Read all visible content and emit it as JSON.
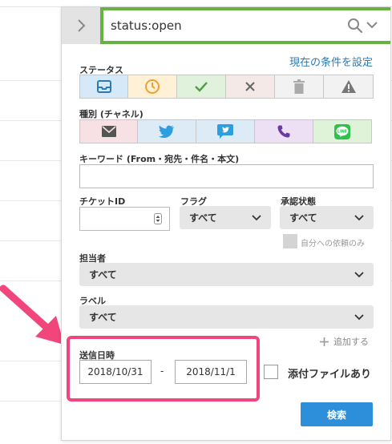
{
  "search": {
    "value": "status:open"
  },
  "panel": {
    "current_conditions_link": "現在の条件を設定"
  },
  "status": {
    "label": "ステータス",
    "options": [
      {
        "icon": "inbox-icon",
        "bg": "#d6e9f8",
        "color": "#2a7ab8"
      },
      {
        "icon": "clock-icon",
        "bg": "#fff1d6",
        "color": "#f0a030"
      },
      {
        "icon": "check-icon",
        "bg": "#e0f2dc",
        "color": "#4aa040"
      },
      {
        "icon": "x-icon",
        "bg": "#f4e9e6",
        "color": "#666"
      },
      {
        "icon": "trash-icon",
        "bg": "#f2f2f2",
        "color": "#aaa"
      },
      {
        "icon": "warning-icon",
        "bg": "#f2f2f2",
        "color": "#777"
      }
    ]
  },
  "channel": {
    "label": "種別 (チャネル)",
    "options": [
      {
        "icon": "email-icon",
        "bg": "#f8e1e4",
        "color": "#555"
      },
      {
        "icon": "twitter-icon",
        "bg": "#dcebf6",
        "color": "#2d9fe0"
      },
      {
        "icon": "twitter-dm-icon",
        "bg": "#dcebf6",
        "color": "#2d9fe0"
      },
      {
        "icon": "phone-icon",
        "bg": "#ede0f4",
        "color": "#6a3aa0"
      },
      {
        "icon": "line-icon",
        "bg": "#dff3d8",
        "color": "#2ec24c"
      }
    ]
  },
  "keyword": {
    "label": "キーワード (From・宛先・件名・本文)",
    "value": ""
  },
  "ticket_id": {
    "label": "チケットID",
    "value": ""
  },
  "flag": {
    "label": "フラグ",
    "selected": "すべて"
  },
  "approval": {
    "label": "承認状態",
    "selected": "すべて",
    "my_requests_label": "自分への依頼のみ"
  },
  "assignee": {
    "label": "担当者",
    "selected": "すべて"
  },
  "tag": {
    "label": "ラベル",
    "selected": "すべて",
    "add_link": "追加する"
  },
  "sent_date": {
    "label": "送信日時",
    "from": "2018/10/31",
    "separator": "-",
    "to": "2018/11/1"
  },
  "attachment": {
    "label": "添付ファイルあり",
    "checked": false
  },
  "submit": {
    "label": "検索"
  },
  "colors": {
    "search_bar": "#68b244",
    "highlight": "#f0467b",
    "button": "#2d8fd9",
    "link": "#2a7ab8"
  }
}
